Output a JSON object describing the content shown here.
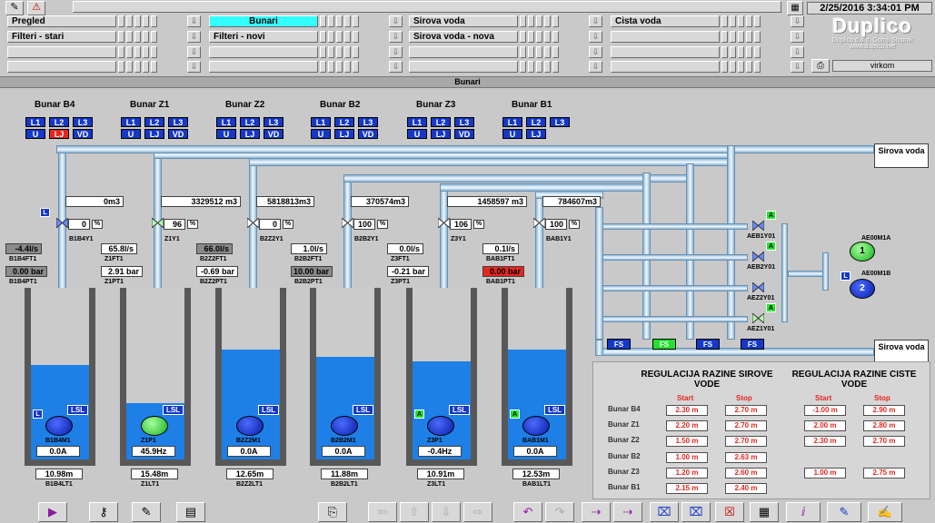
{
  "header": {
    "datetime": "2/25/2016 3:34:01 PM",
    "brand": "Duplico",
    "company": "Duplico d.o.o. Gornji Stupnik",
    "website": "www.duplico.net",
    "user": "virkom",
    "nav": {
      "row1": [
        "Pregled",
        "Bunari",
        "Sirova voda",
        "Cista voda"
      ],
      "row2": [
        "Filteri - stari",
        "Filteri - novi",
        "Sirova voda - nova",
        ""
      ],
      "selected": "Bunari"
    }
  },
  "screen_title": "Bunari",
  "wells": [
    {
      "name": "Bunar B4",
      "flow_total": "0m3",
      "valve_pct": "0",
      "valve_tag": "B1B4Y1",
      "flow": "-4.4l/s",
      "flow_tag": "B1B4FT1",
      "pressure": "0.00 bar",
      "pressure_tag": "B1B4PT1",
      "pump_tag": "B1B4M1",
      "pump_value": "0.0A",
      "level": "10.98m",
      "level_tag": "B1B4LT1",
      "water_fraction": 0.55,
      "pump_on": false
    },
    {
      "name": "Bunar Z1",
      "flow_total": "3329512 m3",
      "valve_pct": "96",
      "valve_tag": "Z1Y1",
      "flow": "65.8l/s",
      "flow_tag": "Z1FT1",
      "pressure": "2.91 bar",
      "pressure_tag": "Z1PT1",
      "pump_tag": "Z1P1",
      "pump_value": "45.9Hz",
      "level": "15.48m",
      "level_tag": "Z1LT1",
      "water_fraction": 0.33,
      "pump_on": true
    },
    {
      "name": "Bunar Z2",
      "flow_total": "5818813m3",
      "valve_pct": "0",
      "valve_tag": "B2Z2Y1",
      "flow": "66.0l/s",
      "flow_tag": "B2Z2FT1",
      "pressure": "-0.69 bar",
      "pressure_tag": "B2Z2PT1",
      "pump_tag": "B2Z2M1",
      "pump_value": "0.0A",
      "level": "12.65m",
      "level_tag": "B2Z2LT1",
      "water_fraction": 0.64,
      "pump_on": false
    },
    {
      "name": "Bunar B2",
      "flow_total": "370574m3",
      "valve_pct": "100",
      "valve_tag": "B2B2Y1",
      "flow": "1.0l/s",
      "flow_tag": "B2B2FT1",
      "pressure": "10.00 bar",
      "pressure_tag": "B2B2PT1",
      "pump_tag": "B2B2M1",
      "pump_value": "0.0A",
      "level": "11.88m",
      "level_tag": "B2B2LT1",
      "water_fraction": 0.6,
      "pump_on": false
    },
    {
      "name": "Bunar Z3",
      "flow_total": "1458597 m3",
      "valve_pct": "106",
      "valve_tag": "Z3Y1",
      "flow": "0.0l/s",
      "flow_tag": "Z3FT1",
      "pressure": "-0.21 bar",
      "pressure_tag": "Z3PT1",
      "pump_tag": "Z3P1",
      "pump_value": "-0.4Hz",
      "level": "10.91m",
      "level_tag": "Z3LT1",
      "water_fraction": 0.57,
      "pump_on": false
    },
    {
      "name": "Bunar B1",
      "flow_total": "784607m3",
      "valve_pct": "100",
      "valve_tag": "BAB1Y1",
      "flow": "0.1l/s",
      "flow_tag": "BAB1FT1",
      "pressure": "0.00 bar",
      "pressure_tag": "BAB1PT1",
      "pump_tag": "BAB1M1",
      "pump_value": "0.0A",
      "level": "12.53m",
      "level_tag": "BAB1LT1",
      "water_fraction": 0.64,
      "pump_on": false
    }
  ],
  "labels": {
    "l1": "L1",
    "l2": "L2",
    "l3": "L3",
    "u": "U",
    "lj": "LJ",
    "vd": "VD",
    "lsl": "LSL",
    "fs": "FS",
    "l": "L",
    "a": "A",
    "pct": "%",
    "sirova_voda": "Sirova voda"
  },
  "valves_right": [
    "AEB1Y01",
    "AEB2Y01",
    "AEZ2Y01",
    "AEZ1Y01"
  ],
  "motors_right": [
    {
      "tag": "AE00M1A",
      "num": "1"
    },
    {
      "tag": "AE00M1B",
      "num": "2"
    }
  ],
  "regulation": {
    "title_left": "REGULACIJA RAZINE SIROVE VODE",
    "title_right": "REGULACIJA RAZINE CISTE VODE",
    "start": "Start",
    "stop": "Stop",
    "rows": [
      {
        "name": "Bunar B4",
        "start": "2.30 m",
        "stop": "2.70 m",
        "c_start": "-1.00 m",
        "c_stop": "2.90 m"
      },
      {
        "name": "Bunar Z1",
        "start": "2.20 m",
        "stop": "2.70 m",
        "c_start": "2.00 m",
        "c_stop": "2.80 m"
      },
      {
        "name": "Bunar Z2",
        "start": "1.50 m",
        "stop": "2.70 m",
        "c_start": "2.30 m",
        "c_stop": "2.70 m"
      },
      {
        "name": "Bunar B2",
        "start": "1.00 m",
        "stop": "2.63 m",
        "c_start": "",
        "c_stop": ""
      },
      {
        "name": "Bunar Z3",
        "start": "1.20 m",
        "stop": "2.60 m",
        "c_start": "1.00 m",
        "c_stop": "2.75 m"
      },
      {
        "name": "Bunar B1",
        "start": "2.15 m",
        "stop": "2.40 m",
        "c_start": "",
        "c_stop": ""
      }
    ]
  }
}
